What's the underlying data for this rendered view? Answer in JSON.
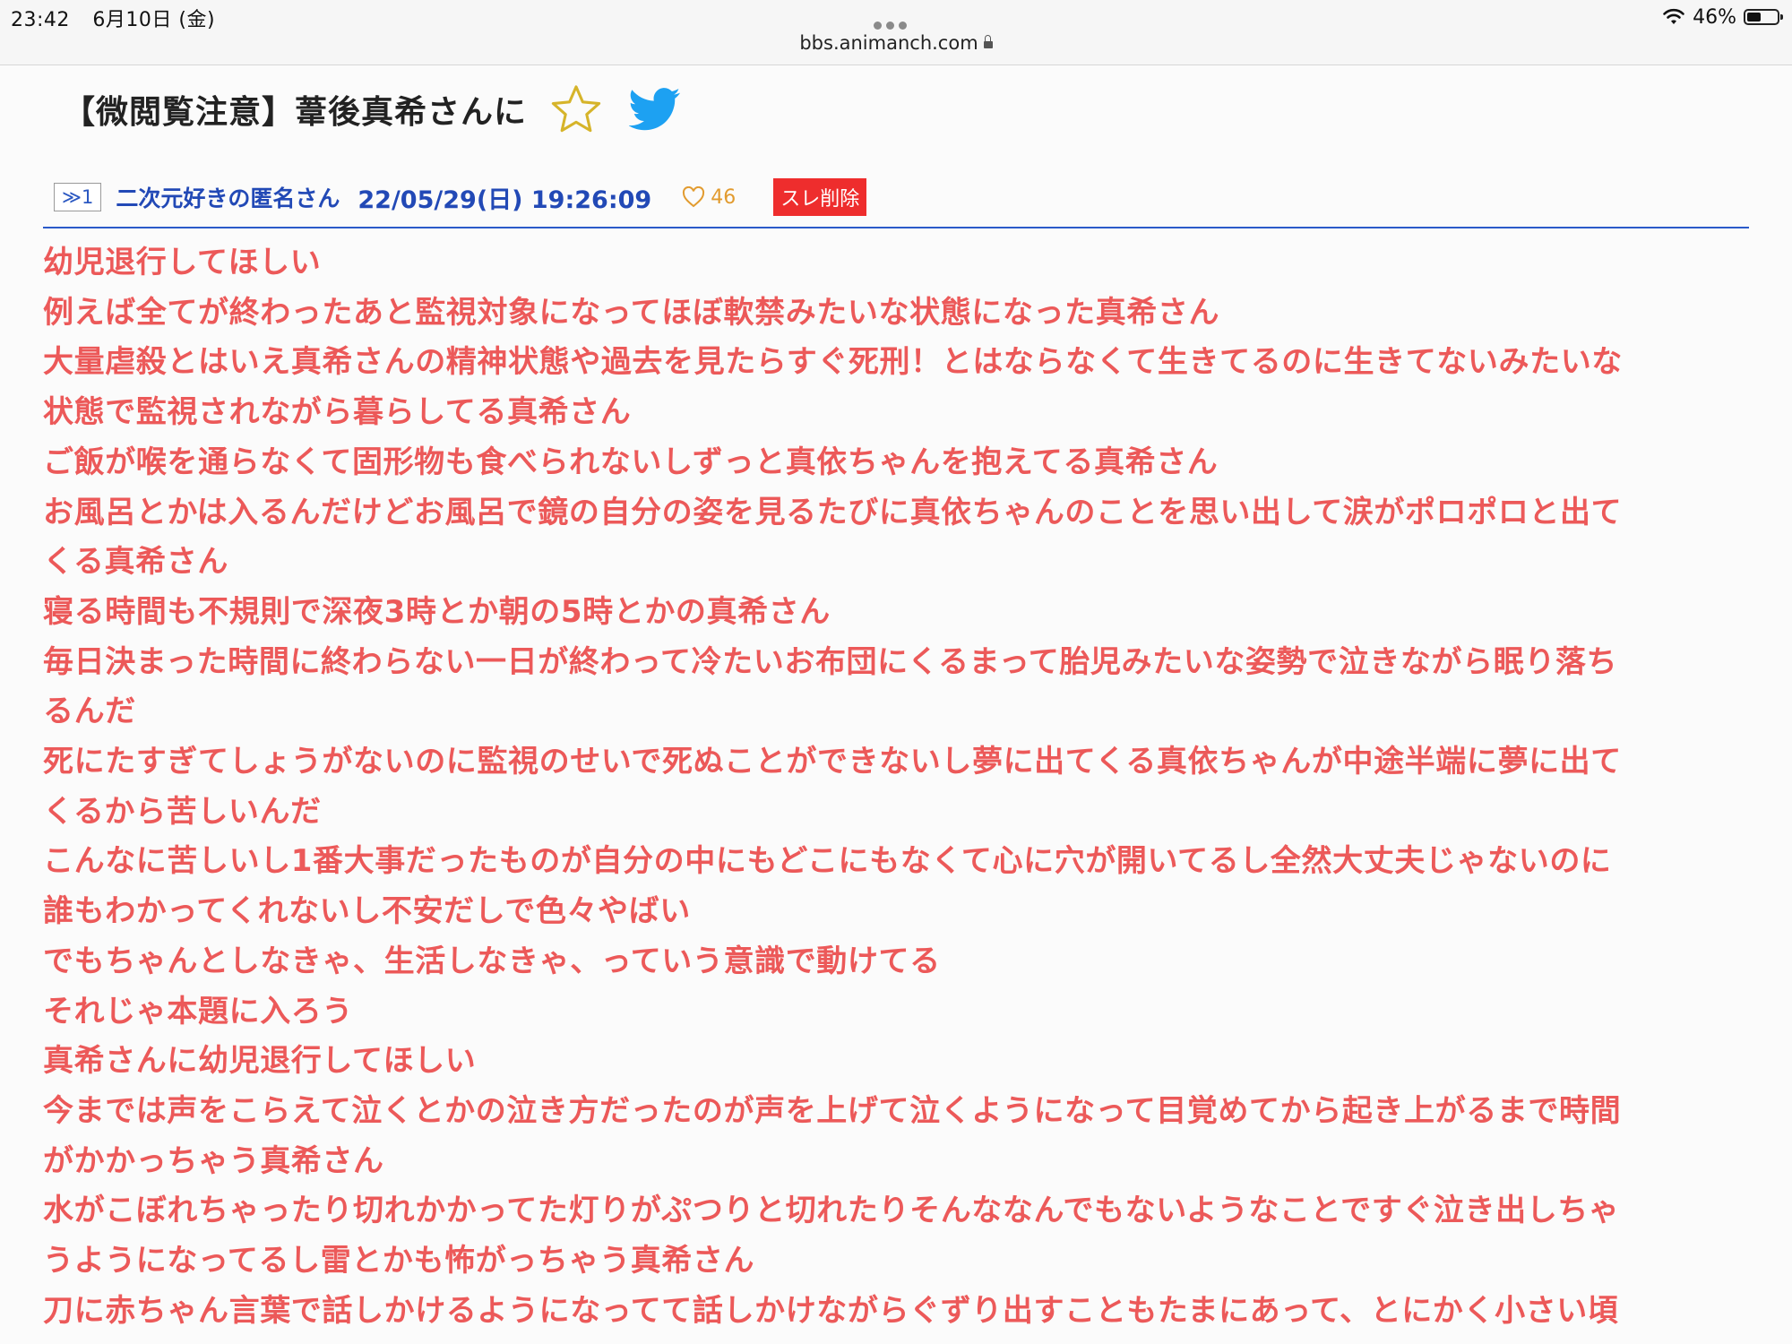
{
  "status_bar": {
    "time": "23:42",
    "date": "6月10日 (金)",
    "battery_percent": "46%",
    "battery_level": 0.46
  },
  "address_bar": {
    "url": "bbs.animanch.com"
  },
  "thread": {
    "title": "【微閲覧注意】葦後真希さんに"
  },
  "post": {
    "number": "≫1",
    "author": "二次元好きの匿名さん",
    "datetime": "22/05/29(日) 19:26:09",
    "likes": "46",
    "delete_label": "スレ削除",
    "lines": [
      "幼児退行してほしい",
      "例えば全てが終わったあと監視対象になってほぼ軟禁みたいな状態になった真希さん",
      "大量虐殺とはいえ真希さんの精神状態や過去を見たらすぐ死刑！とはならなくて生きてるのに生きてないみたいな",
      "状態で監視されながら暮らしてる真希さん",
      "ご飯が喉を通らなくて固形物も食べられないしずっと真依ちゃんを抱えてる真希さん",
      "お風呂とかは入るんだけどお風呂で鏡の自分の姿を見るたびに真依ちゃんのことを思い出して涙がポロポロと出て",
      "くる真希さん",
      "寝る時間も不規則で深夜3時とか朝の5時とかの真希さん",
      "毎日決まった時間に終わらない一日が終わって冷たいお布団にくるまって胎児みたいな姿勢で泣きながら眠り落ち",
      "るんだ",
      "死にたすぎてしょうがないのに監視のせいで死ぬことができないし夢に出てくる真依ちゃんが中途半端に夢に出て",
      "くるから苦しいんだ",
      "こんなに苦しいし1番大事だったものが自分の中にもどこにもなくて心に穴が開いてるし全然大丈夫じゃないのに",
      "誰もわかってくれないし不安だしで色々やばい",
      "でもちゃんとしなきゃ、生活しなきゃ、っていう意識で動けてる",
      "それじゃ本題に入ろう",
      "真希さんに幼児退行してほしい",
      "今までは声をこらえて泣くとかの泣き方だったのが声を上げて泣くようになって目覚めてから起き上がるまで時間",
      "がかかっちゃう真希さん",
      "水がこぼれちゃったり切れかかってた灯りがぷつりと切れたりそんななんでもないようなことですぐ泣き出しちゃ",
      "うようになってるし雷とかも怖がっちゃう真希さん",
      "刀に赤ちゃん言葉で話しかけるようになってて話しかけながらぐずり出すこともたまにあって、とにかく小さい頃"
    ]
  },
  "colors": {
    "body_text": "#ec5959",
    "meta_blue": "#2249b6",
    "divider": "#2a5ac9",
    "like": "#e29b2f",
    "delete_bg": "#ee2d2d",
    "star": "#d6b42a",
    "twitter": "#1da1f2"
  },
  "icons": {
    "favorite": "star-outline-icon",
    "share": "twitter-bird-icon",
    "like": "heart-outline-icon",
    "secure": "lock-icon",
    "wifi": "wifi-icon",
    "battery": "battery-icon",
    "menu": "more-dots-icon"
  }
}
